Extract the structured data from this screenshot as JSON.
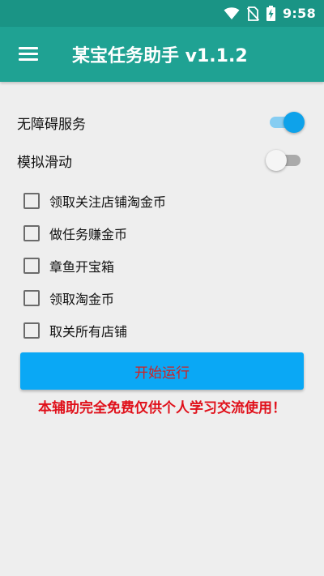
{
  "status_bar": {
    "time": "9:58",
    "icons": [
      "wifi-icon",
      "no-sim-icon",
      "battery-charging-icon"
    ]
  },
  "app_bar": {
    "menu_icon": "hamburger-menu-icon",
    "title": "某宝任务助手 v1.1.2"
  },
  "toggles": [
    {
      "label": "无障碍服务",
      "on": true
    },
    {
      "label": "模拟滑动",
      "on": false
    }
  ],
  "checkboxes": [
    {
      "label": "领取关注店铺淘金币",
      "checked": false
    },
    {
      "label": "做任务赚金币",
      "checked": false
    },
    {
      "label": "章鱼开宝箱",
      "checked": false
    },
    {
      "label": "领取淘金币",
      "checked": false
    },
    {
      "label": "取关所有店铺",
      "checked": false
    }
  ],
  "start_button": {
    "label": "开始运行"
  },
  "notice": "本辅助完全免费仅供个人学习交流使用！",
  "colors": {
    "status_bar": "#1a9485",
    "app_bar": "#1fa293",
    "switch_on": "#0ea2ea",
    "button": "#0aa8f5",
    "notice_text": "#e0101a"
  }
}
